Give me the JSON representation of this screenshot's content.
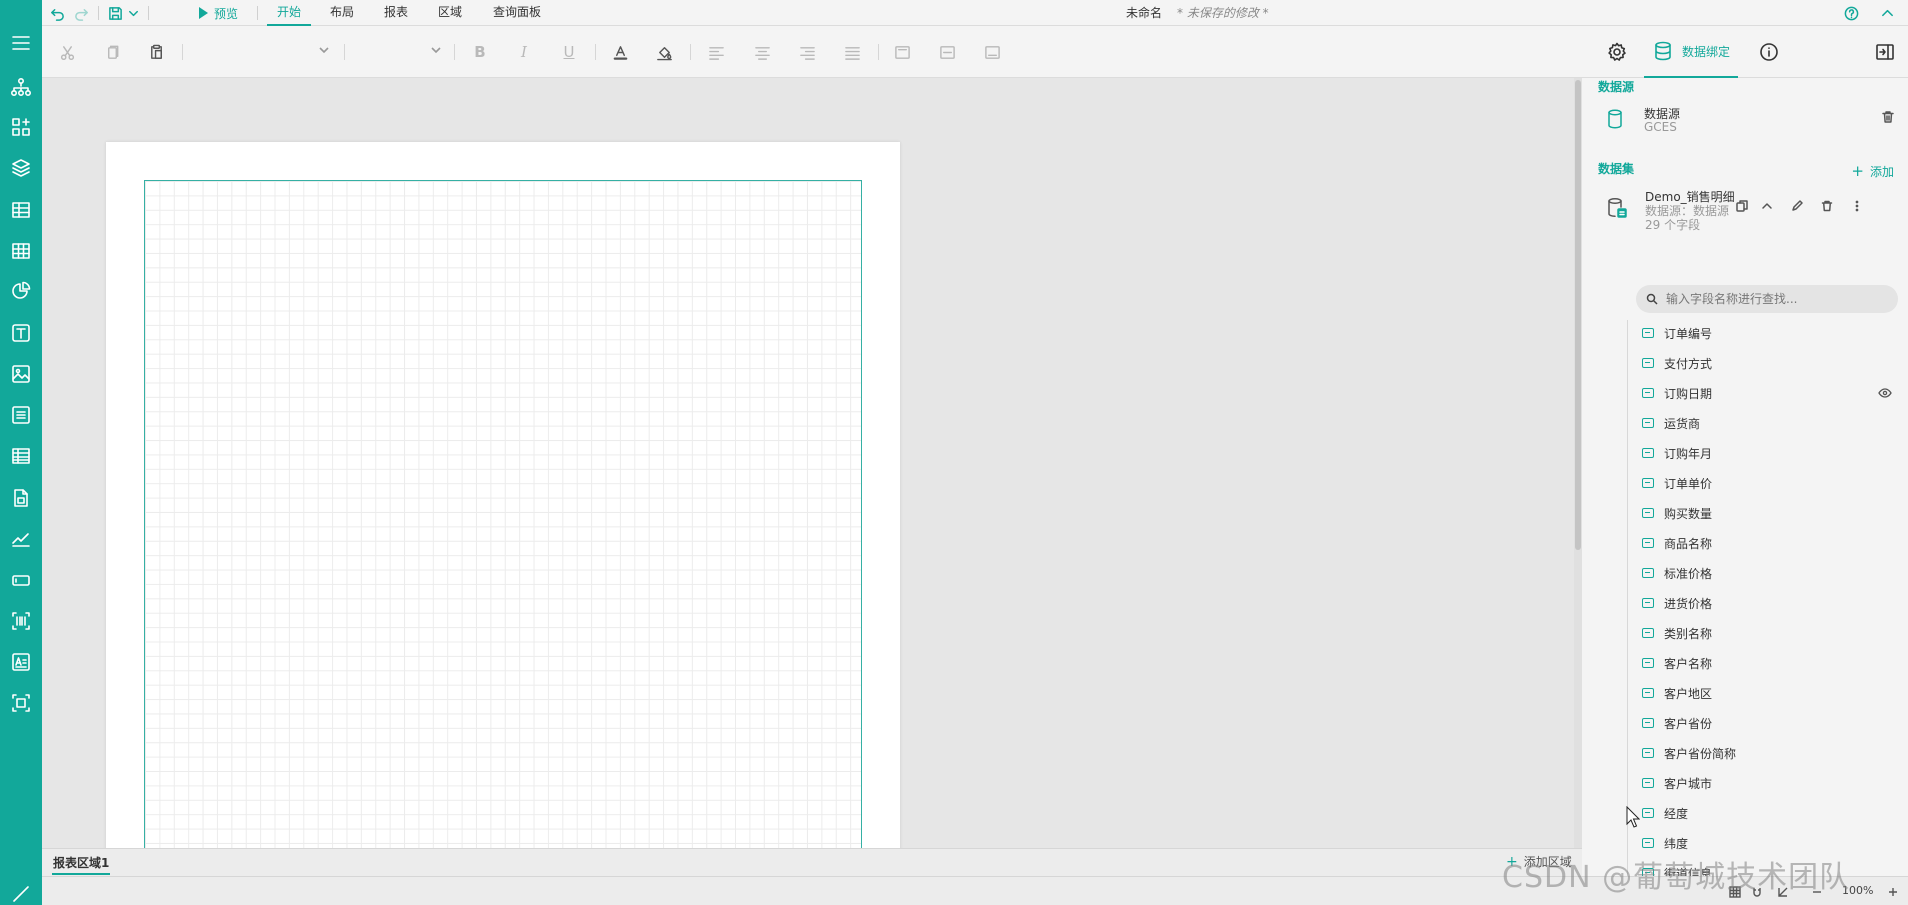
{
  "titlebar": {
    "doc_name": "未命名",
    "unsaved_note": "* 未保存的修改 *"
  },
  "menu": {
    "preview_label": "预览",
    "tabs": [
      {
        "label": "开始",
        "active": true
      },
      {
        "label": "布局",
        "active": false
      },
      {
        "label": "报表",
        "active": false
      },
      {
        "label": "区域",
        "active": false
      },
      {
        "label": "查询面板",
        "active": false
      }
    ]
  },
  "right_tabs": {
    "data_binding_label": "数据绑定"
  },
  "panel": {
    "datasource_section_title": "数据源",
    "datasource": {
      "name": "数据源",
      "type": "GCES"
    },
    "dataset_section_title": "数据集",
    "add_label": "添加",
    "dataset": {
      "name": "Demo_销售明细",
      "source_text": "数据源：数据源",
      "field_count_text": "29 个字段"
    },
    "search_placeholder": "输入字段名称进行查找...",
    "fields": [
      {
        "label": "订单编号"
      },
      {
        "label": "支付方式"
      },
      {
        "label": "订购日期"
      },
      {
        "label": "运货商"
      },
      {
        "label": "订购年月"
      },
      {
        "label": "订单单价"
      },
      {
        "label": "购买数量"
      },
      {
        "label": "商品名称"
      },
      {
        "label": "标准价格"
      },
      {
        "label": "进货价格"
      },
      {
        "label": "类别名称"
      },
      {
        "label": "客户名称"
      },
      {
        "label": "客户地区"
      },
      {
        "label": "客户省份"
      },
      {
        "label": "客户省份简称"
      },
      {
        "label": "客户城市"
      },
      {
        "label": "经度"
      },
      {
        "label": "纬度"
      },
      {
        "label": "街道信息"
      }
    ]
  },
  "bottom": {
    "area_tab_label": "报表区域1",
    "add_area_label": "添加区域",
    "zoom_label": "100%"
  },
  "watermark": "CSDN @葡萄城技术团队",
  "colors": {
    "accent": "#12a89a",
    "rail_bg": "#12a89a",
    "canvas_bg": "#e6e6e6",
    "panel_bg": "#f4f4f4"
  },
  "icons": {
    "rail": [
      "hamburger-icon",
      "hierarchy-icon",
      "layout-icon",
      "layers-icon",
      "table-icon",
      "grid-icon",
      "pie-chart-icon",
      "text-box-icon",
      "image-icon",
      "list-icon",
      "tablix-icon",
      "subreport-icon",
      "sparkline-icon",
      "input-icon",
      "barcode-icon",
      "richtext-icon",
      "container-icon",
      "line-icon"
    ]
  }
}
